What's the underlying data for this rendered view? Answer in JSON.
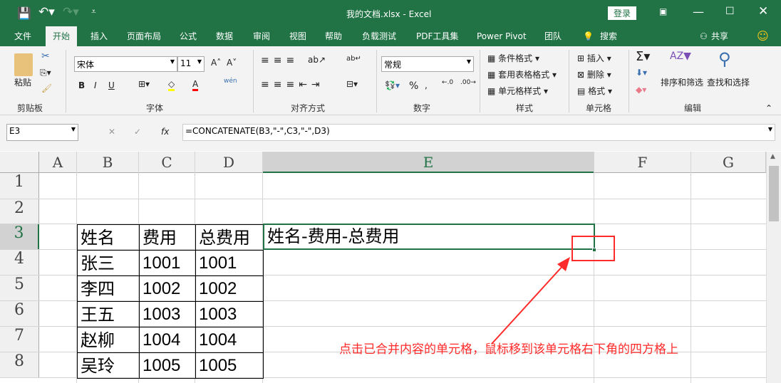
{
  "title": "我的文档.xlsx  -  Excel",
  "login": "登录",
  "tabs": [
    "文件",
    "开始",
    "插入",
    "页面布局",
    "公式",
    "数据",
    "审阅",
    "视图",
    "帮助",
    "负载测试",
    "PDF工具集",
    "Power Pivot",
    "团队",
    "搜索"
  ],
  "share": "共享",
  "ribbon": {
    "paste": "粘贴",
    "clipboard": "剪贴板",
    "font_name": "宋体",
    "font_size": "11",
    "font": "字体",
    "bold": "B",
    "italic": "I",
    "underline": "U",
    "phonetic": "wén",
    "alignment": "对齐方式",
    "number_format": "常规",
    "number": "数字",
    "cond_format": "条件格式",
    "table_format": "套用表格格式",
    "cell_style": "单元格样式",
    "styles": "样式",
    "insert": "插入",
    "delete": "删除",
    "format": "格式",
    "cells": "单元格",
    "sort_filter": "排序和筛选",
    "find_select": "查找和选择",
    "editing": "编辑"
  },
  "formula_bar": {
    "name_box": "E3",
    "fx": "fx",
    "formula": "=CONCATENATE(B3,\"-\",C3,\"-\",D3)"
  },
  "columns": [
    "A",
    "B",
    "C",
    "D",
    "E",
    "F",
    "G"
  ],
  "rows": [
    "1",
    "2",
    "3",
    "4",
    "5",
    "6",
    "7",
    "8"
  ],
  "table": [
    [
      "姓名",
      "费用",
      "总费用"
    ],
    [
      "张三",
      "1001",
      "1001"
    ],
    [
      "李四",
      "1002",
      "1002"
    ],
    [
      "王五",
      "1003",
      "1003"
    ],
    [
      "赵柳",
      "1004",
      "1004"
    ],
    [
      "吴玲",
      "1005",
      "1005"
    ]
  ],
  "e3": "姓名-费用-总费用",
  "annotation": "点击已合并内容的单元格，鼠标移到该单元格右下角的四方格上",
  "colors": {
    "accent": "#217346",
    "annotation": "#ff2a2a"
  }
}
